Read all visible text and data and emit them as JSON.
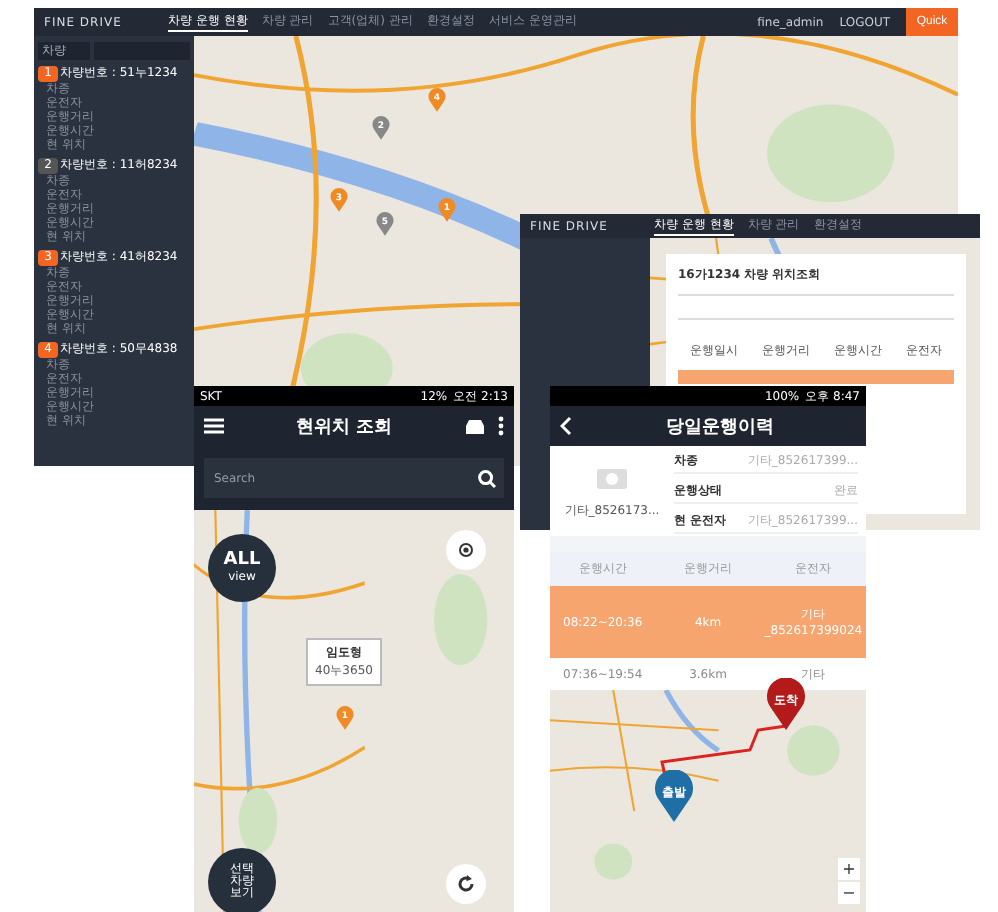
{
  "desktop_main": {
    "logo": "FINE DRIVE",
    "nav": [
      {
        "label": "차량 운행 현황",
        "selected": true
      },
      {
        "label": "차량 관리",
        "selected": false
      },
      {
        "label": "고객(업체) 관리",
        "selected": false
      },
      {
        "label": "환경설정",
        "selected": false
      },
      {
        "label": "서비스 운영관리",
        "selected": false
      }
    ],
    "user": "fine_admin",
    "logout": "LOGOUT",
    "quick": "Quick",
    "filter": "차량",
    "vehicles": [
      {
        "number": "1",
        "plate": "차량번호 : 51누1234",
        "active": true,
        "fields": [
          "차종",
          "운전자",
          "운행거리",
          "운행시간",
          "현 위치"
        ]
      },
      {
        "number": "2",
        "plate": "차량번호 : 11허8234",
        "active": false,
        "fields": [
          "차종",
          "운전자",
          "운행거리",
          "운행시간",
          "현 위치"
        ]
      },
      {
        "number": "3",
        "plate": "차량번호 : 41허8234",
        "active": true,
        "fields": [
          "차종",
          "운전자",
          "운행거리",
          "운행시간",
          "현 위치"
        ]
      },
      {
        "number": "4",
        "plate": "차량번호 : 50무4838",
        "active": true,
        "fields": [
          "차종",
          "운전자",
          "운행거리",
          "운행시간",
          "현 위치"
        ]
      }
    ],
    "pins": [
      {
        "number": "4",
        "active": true
      },
      {
        "number": "2",
        "active": false
      },
      {
        "number": "3",
        "active": true
      },
      {
        "number": "5",
        "active": false
      },
      {
        "number": "1",
        "active": true
      }
    ]
  },
  "desktop_detail": {
    "logo": "FINE DRIVE",
    "nav": [
      {
        "label": "차량 운행 현황",
        "selected": true
      },
      {
        "label": "차량 관리",
        "selected": false
      },
      {
        "label": "환경설정",
        "selected": false
      }
    ],
    "popup": {
      "title": "16가1234 차량 위치조회",
      "columns": [
        "운행일시",
        "운행거리",
        "운행시간",
        "운전자"
      ]
    }
  },
  "phone_location": {
    "status": {
      "carrier": "SKT",
      "battery": "12%",
      "time": "오전 2:13"
    },
    "title": "현위치 조회",
    "search": {
      "placeholder": "Search"
    },
    "all_view": [
      "ALL",
      "view"
    ],
    "callout": {
      "name": "임도형",
      "plate": "40누3650"
    },
    "pin": "1",
    "selected_view": [
      "선택",
      "차량",
      "보기"
    ]
  },
  "phone_history": {
    "status": {
      "battery": "100%",
      "time": "오후 8:47"
    },
    "title": "당일운행이력",
    "vehicle_name": "기타_8526173...",
    "fields": [
      {
        "label": "차종",
        "value": "기타_852617399..."
      },
      {
        "label": "운행상태",
        "value": "완료"
      },
      {
        "label": "현 운전자",
        "value": "기타_852617399..."
      }
    ],
    "columns": [
      "운행시간",
      "운행거리",
      "운전자"
    ],
    "rows": [
      {
        "time": "08:22~20:36",
        "distance": "4km",
        "driver": "기타 _852617399024",
        "selected": true
      },
      {
        "time": "07:36~19:54",
        "distance": "3.6km",
        "driver": "기타",
        "selected": false
      }
    ],
    "end_pin": "도착",
    "start_pin": "출발",
    "zoom_in": "+",
    "zoom_out": "−"
  }
}
